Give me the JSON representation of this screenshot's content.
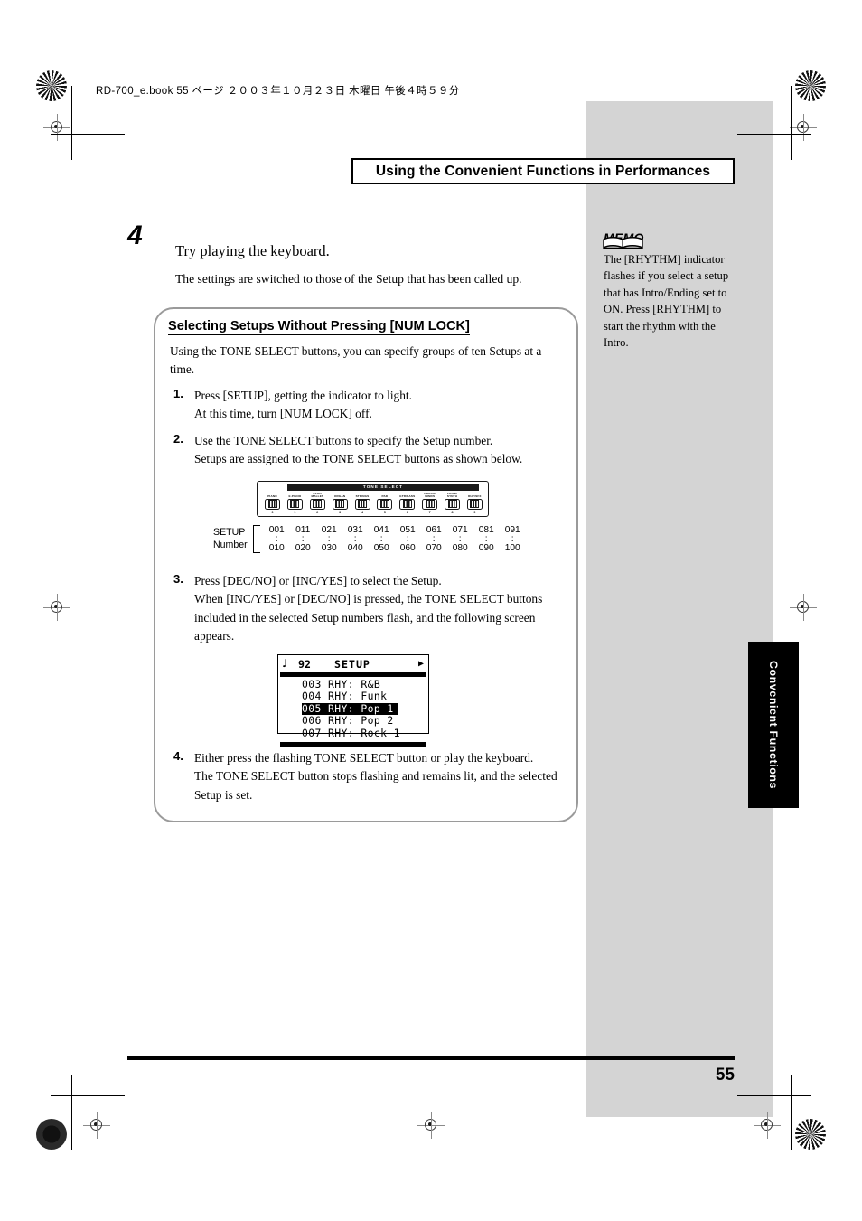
{
  "file_header": "RD-700_e.book 55 ページ ２００３年１０月２３日  木曜日  午後４時５９分",
  "running_title": "Using the Convenient Functions in Performances",
  "main_step": {
    "number": "4",
    "title": "Try playing the keyboard.",
    "body": "The settings are switched to those of the Setup that has been called up."
  },
  "memo": {
    "label": "MEMO",
    "text": "The [RHYTHM] indicator flashes if you select a setup that has Intro/Ending set to ON. Press [RHYTHM] to start the rhythm with the Intro."
  },
  "subbox": {
    "title": "Selecting Setups Without Pressing [NUM LOCK]",
    "intro": "Using the TONE SELECT buttons, you can specify groups of ten Setups at a time.",
    "steps": [
      {
        "num": "1.",
        "line1": "Press [SETUP], getting the indicator to light.",
        "line2": "At this time, turn [NUM LOCK] off."
      },
      {
        "num": "2.",
        "line1": "Use the TONE SELECT buttons to specify the Setup number.",
        "line2": "Setups are assigned to the TONE SELECT buttons as shown below."
      },
      {
        "num": "3.",
        "line1": "Press [DEC/NO] or [INC/YES] to select the Setup.",
        "line2": "When [INC/YES] or [DEC/NO] is pressed, the TONE SELECT buttons included in the selected Setup numbers flash, and the following screen appears."
      },
      {
        "num": "4.",
        "line1": "Either press the flashing TONE SELECT button or play the keyboard.",
        "line2": "The TONE SELECT button stops flashing and remains lit, and the selected Setup is set."
      }
    ]
  },
  "tone_select_figure": {
    "header": "TONE SELECT",
    "buttons": [
      {
        "label": "PIANO",
        "label2": "",
        "number": "0"
      },
      {
        "label": "E.PIANO",
        "label2": "",
        "number": "1"
      },
      {
        "label": "CLAV/",
        "label2": "MALLET",
        "number": "2"
      },
      {
        "label": "ORGAN",
        "label2": "",
        "number": "3"
      },
      {
        "label": "STRINGS",
        "label2": "",
        "number": "4"
      },
      {
        "label": "PAD",
        "label2": "",
        "number": "5"
      },
      {
        "label": "GTR/BASS",
        "label2": "",
        "number": "6"
      },
      {
        "label": "BRASS/",
        "label2": "WINDS",
        "number": "7"
      },
      {
        "label": "VOICE/",
        "label2": "SYNTH",
        "number": "8"
      },
      {
        "label": "RHY/SFX",
        "label2": "",
        "number": "9"
      }
    ]
  },
  "setup_number_table": {
    "label_line1": "SETUP",
    "label_line2": "Number",
    "top_row": [
      "001",
      "011",
      "021",
      "031",
      "041",
      "051",
      "061",
      "071",
      "081",
      "091"
    ],
    "dots_row": [
      ":",
      ":",
      ":",
      ":",
      ":",
      ":",
      ":",
      ":",
      ":",
      ":"
    ],
    "bottom_row": [
      "010",
      "020",
      "030",
      "040",
      "050",
      "060",
      "070",
      "080",
      "090",
      "100"
    ]
  },
  "lcd": {
    "note_glyph": "♩",
    "tempo": "92",
    "mode": "SETUP",
    "arrow_glyph": "▶",
    "rows": [
      {
        "text": "003 RHY: R&B",
        "selected": false
      },
      {
        "text": "004 RHY: Funk",
        "selected": false
      },
      {
        "text": "005 RHY: Pop 1",
        "selected": true
      },
      {
        "text": "006 RHY: Pop 2",
        "selected": false
      },
      {
        "text": "007 RHY: Rock 1",
        "selected": false
      }
    ]
  },
  "side_tab": "Convenient Functions",
  "page_number": "55"
}
